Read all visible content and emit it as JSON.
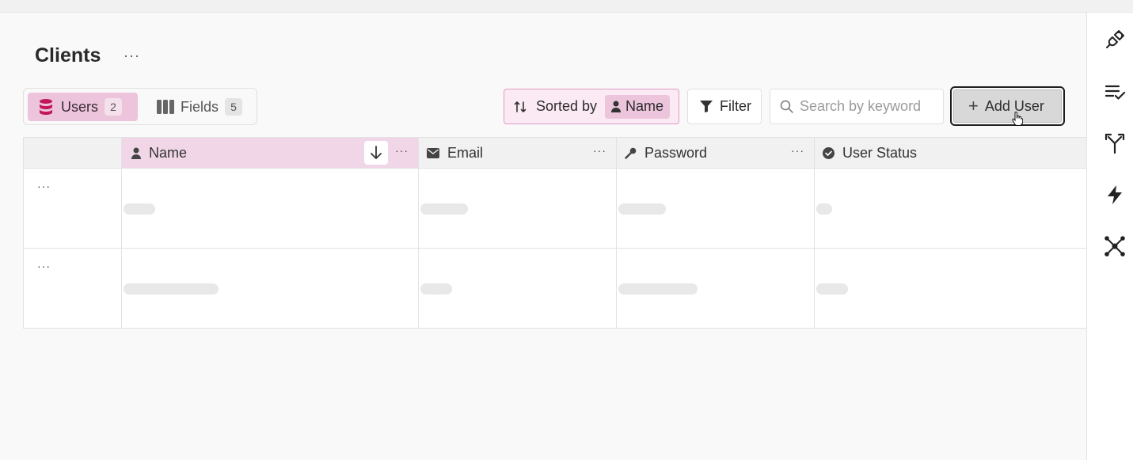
{
  "page": {
    "title": "Clients",
    "title_menu": "···"
  },
  "tabs": [
    {
      "label": "Users",
      "count": "2",
      "icon": "database-icon",
      "active": true
    },
    {
      "label": "Fields",
      "count": "5",
      "icon": "columns-icon",
      "active": false
    }
  ],
  "toolbar": {
    "sorted_label": "Sorted by",
    "sorted_field": "Name",
    "filter_label": "Filter",
    "search_placeholder": "Search by keyword",
    "add_label": "Add User"
  },
  "table": {
    "columns": [
      {
        "label": "Name",
        "icon": "person-icon",
        "menu": "···"
      },
      {
        "label": "Email",
        "icon": "envelope-icon",
        "menu": "···"
      },
      {
        "label": "Password",
        "icon": "key-icon",
        "menu": "···"
      },
      {
        "label": "User Status",
        "icon": "check-circle-icon"
      }
    ],
    "row_menu": "···",
    "rows": [
      {
        "loading": true
      },
      {
        "loading": true
      }
    ]
  },
  "rightbar": {
    "icons": [
      "plug-icon",
      "checklist-icon",
      "branch-icon",
      "bolt-icon",
      "network-icon"
    ]
  },
  "colors": {
    "accent": "#ecc4dc",
    "accent_border": "#df9cc3",
    "brand": "#c2185b"
  }
}
